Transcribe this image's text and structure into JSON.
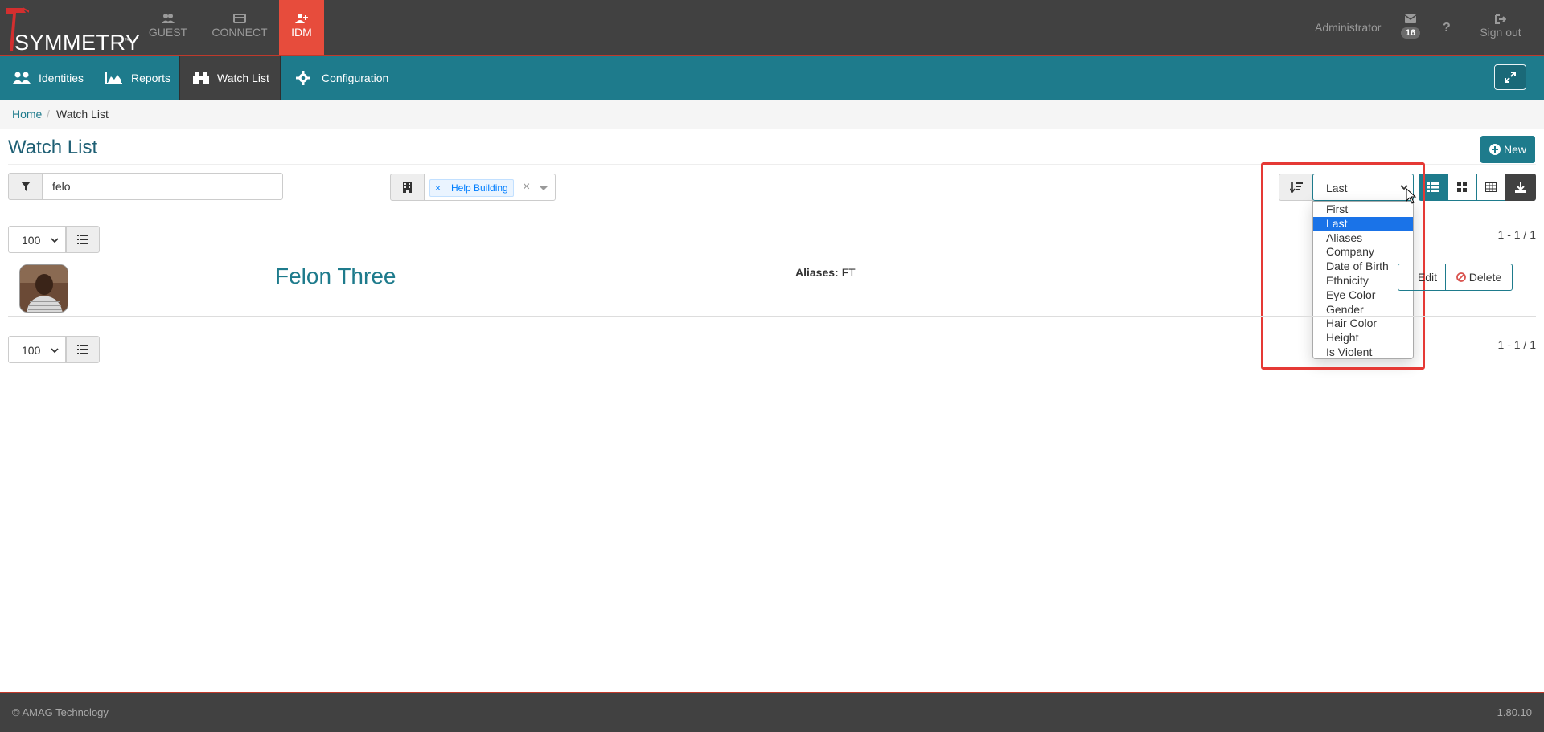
{
  "app": {
    "brand": "SYMMETRY",
    "trademark": "™",
    "modules": [
      {
        "label": "GUEST",
        "icon": "users-icon"
      },
      {
        "label": "CONNECT",
        "icon": "card-icon"
      },
      {
        "label": "IDM",
        "icon": "user-plus-icon",
        "active": true
      }
    ],
    "user": "Administrator",
    "mail_count": "16",
    "help": "?",
    "signout": "Sign out"
  },
  "nav": {
    "items": [
      {
        "label": "Identities",
        "icon": "users-icon"
      },
      {
        "label": "Reports",
        "icon": "area-chart-icon"
      },
      {
        "label": "Watch List",
        "icon": "binoculars-icon",
        "active": true
      },
      {
        "label": "Configuration",
        "icon": "gear-icon"
      }
    ]
  },
  "breadcrumb": {
    "home": "Home",
    "separator": "/",
    "current": "Watch List"
  },
  "page": {
    "title": "Watch List",
    "new_label": "New",
    "search_value": "felo",
    "building_tag": "Help Building",
    "tag_remove": "×",
    "clear": "×",
    "sort_value": "Last",
    "sort_options": [
      "First",
      "Last",
      "Aliases",
      "Company",
      "Date of Birth",
      "Ethnicity",
      "Eye Color",
      "Gender",
      "Hair Color",
      "Height",
      "Is Violent"
    ],
    "page_size": "100",
    "count_text": "1 - 1 / 1"
  },
  "record": {
    "name": "Felon Three",
    "aliases_label": "Aliases:",
    "aliases_value": "FT",
    "edit_label": "Edit",
    "delete_label": "Delete"
  },
  "footer": {
    "copyright": "© AMAG Technology",
    "version": "1.80.10"
  },
  "colors": {
    "teal": "#1e7b8c",
    "dark": "#414141",
    "red": "#e74c3c",
    "highlight": "#e53935"
  }
}
